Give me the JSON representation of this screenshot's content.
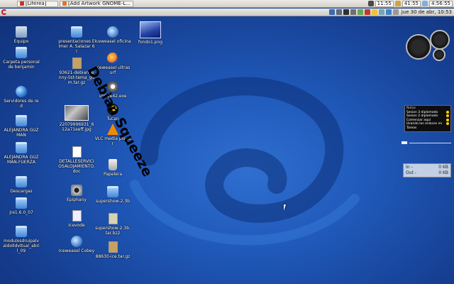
{
  "taskbar": {
    "tasks": [
      {
        "label": "[Liferea]"
      },
      {
        "label": "[Add Artwork GNOME-L..."
      }
    ],
    "tray": {
      "time_a": "11:55",
      "time_b": "41:55",
      "time_c": "4:56:55"
    }
  },
  "panel": {
    "clock": "jue 30 de abr, 10:53"
  },
  "desktop_icons": [
    {
      "label": "Equipo",
      "icon": "computer-icon"
    },
    {
      "label": "Carpeta personal de benjamin",
      "icon": "home-folder-icon"
    },
    {
      "label": "Servidores de red",
      "icon": "network-icon"
    },
    {
      "label": "ALEJANDRA GUZMAN",
      "icon": "folder-icon"
    },
    {
      "label": "ALEJANDRA GUZMAN-FUERZA",
      "icon": "folder-icon"
    },
    {
      "label": "Descargas",
      "icon": "folder-icon"
    },
    {
      "label": "jre1.6.0_07",
      "icon": "folder-icon"
    },
    {
      "label": "modulosdruipalvaldolldvItual_abril_09",
      "icon": "folder-icon"
    },
    {
      "label": "presentaciones Elmer A. Salazar 6i",
      "icon": "folder-icon"
    },
    {
      "label": "93621-debian-lenny-list-tema_gdm.tar.gz",
      "icon": "archive-icon"
    },
    {
      "label": "22079996931_612a71eeff.jpg",
      "icon": "image-icon"
    },
    {
      "label": "DETALLESERVICIOSALOJAMIENTO.doc",
      "icon": "document-icon"
    },
    {
      "label": "Epiphany",
      "icon": "epiphany-icon"
    },
    {
      "label": "Icevode",
      "icon": "icevode-icon"
    },
    {
      "label": "Iceweasel Cobey",
      "icon": "iceweasel-icon"
    },
    {
      "label": "Iceweasel oficina",
      "icon": "iceweasel-icon"
    },
    {
      "label": "Iceweasel ultrasurf",
      "icon": "iceweasel-icon"
    },
    {
      "label": "u991e42.exe",
      "icon": "gear-icon"
    },
    {
      "label": "Tucan",
      "icon": "tucan-icon"
    },
    {
      "label": "VLC media player",
      "icon": "vlc-cone-icon"
    },
    {
      "label": "Papelera",
      "icon": "trash-icon"
    },
    {
      "label": "supershow-2.3b",
      "icon": "folder-icon"
    },
    {
      "label": "supershow-2.3b.tar.bz2",
      "icon": "archive-icon"
    },
    {
      "label": "88630-ice.tar.gz",
      "icon": "archive-icon"
    },
    {
      "label": "fondo1.png",
      "icon": "wallpaper-image-icon"
    }
  ],
  "wallpaper_text": "Debian Squeeze",
  "notes_widget": {
    "title": "Notas",
    "items": [
      "Sesion 3 diplomado",
      "Sesion 2 diplomado",
      "Comenzar aqui",
      "Usando los enlaces en",
      "Tareas"
    ]
  },
  "net_monitor": {
    "in_label": "In -",
    "in_value": "0 KB",
    "out_label": "Out -",
    "out_value": "0 KB"
  },
  "colors": {
    "desktop_blue": "#1f58b8",
    "panel_gray": "#d4d0c8"
  }
}
